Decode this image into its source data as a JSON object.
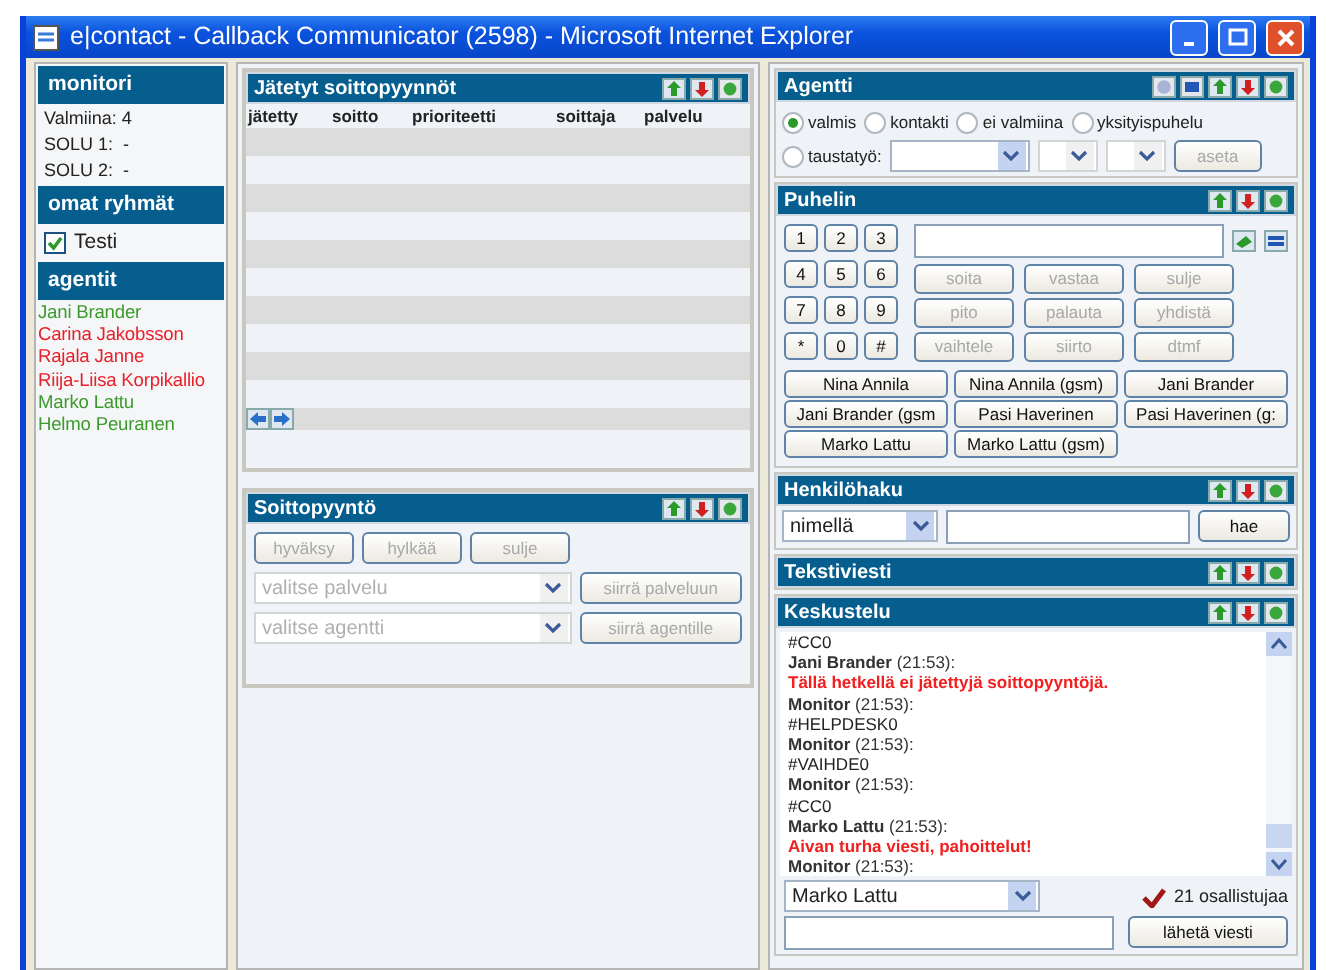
{
  "window": {
    "title": "e|contact - Callback Communicator (2598) - Microsoft Internet Explorer"
  },
  "monitor": {
    "title": "monitori",
    "lines": [
      "Valmiina: 4",
      "SOLU 1:  -",
      "SOLU 2:  -"
    ]
  },
  "groups": {
    "title": "omat ryhmät",
    "items": [
      {
        "label": "Testi",
        "checked": true
      }
    ]
  },
  "agents": {
    "title": "agentit",
    "items": [
      {
        "name": "Jani Brander",
        "color": "#3c9a2c"
      },
      {
        "name": "Carina Jakobsson",
        "color": "#e8202a"
      },
      {
        "name": "Rajala Janne",
        "color": "#e8202a"
      },
      {
        "name": "Riija-Liisa Korpikallio",
        "color": "#e8202a"
      },
      {
        "name": "Marko Lattu",
        "color": "#3c9a2c"
      },
      {
        "name": "Helmo Peuranen",
        "color": "#3c9a2c"
      }
    ]
  },
  "requests": {
    "title": "Jätetyt soittopyynnöt",
    "columns": [
      "jätetty",
      "soitto",
      "prioriteetti",
      "soittaja",
      "palvelu"
    ]
  },
  "callback": {
    "title": "Soittopyyntö",
    "buttons": [
      {
        "label": "hyväksy",
        "disabled": true
      },
      {
        "label": "hylkää",
        "disabled": true
      },
      {
        "label": "sulje",
        "disabled": true
      }
    ],
    "transfers": [
      {
        "placeholder": "valitse palvelu",
        "button": "siirrä palveluun",
        "disabled": true
      },
      {
        "placeholder": "valitse agentti",
        "button": "siirrä agentille",
        "disabled": true
      }
    ]
  },
  "agent_panel": {
    "title": "Agentti",
    "statuses": [
      {
        "label": "valmis",
        "selected": true
      },
      {
        "label": "kontakti",
        "selected": false
      },
      {
        "label": "ei valmiina",
        "selected": false
      },
      {
        "label": "yksityispuhelu",
        "selected": false
      },
      {
        "label": "taustatyö:",
        "selected": false
      }
    ],
    "work_selects": [
      {
        "disabled": false
      },
      {
        "disabled": true
      },
      {
        "disabled": true
      }
    ],
    "set_button": {
      "label": "aseta",
      "disabled": true
    }
  },
  "phone": {
    "title": "Puhelin",
    "keys": [
      "1",
      "2",
      "3",
      "4",
      "5",
      "6",
      "7",
      "8",
      "9",
      "*",
      "0",
      "#"
    ],
    "actions": [
      {
        "label": "soita",
        "disabled": true
      },
      {
        "label": "vastaa",
        "disabled": true
      },
      {
        "label": "sulje",
        "disabled": true
      },
      {
        "label": "pito",
        "disabled": true
      },
      {
        "label": "palauta",
        "disabled": true
      },
      {
        "label": "yhdistä",
        "disabled": true
      },
      {
        "label": "vaihtele",
        "disabled": true
      },
      {
        "label": "siirto",
        "disabled": true
      },
      {
        "label": "dtmf",
        "disabled": true
      }
    ],
    "contacts": [
      "Nina Annila",
      "Nina Annila (gsm)",
      "Jani Brander",
      "Jani Brander (gsm",
      "Pasi Haverinen",
      "Pasi Haverinen (g:",
      "Marko Lattu",
      "Marko Lattu (gsm)"
    ]
  },
  "search": {
    "title": "Henkilöhaku",
    "by": "nimellä",
    "button": "hae"
  },
  "sms": {
    "title": "Tekstiviesti"
  },
  "chat": {
    "title": "Keskustelu",
    "messages": [
      {
        "kind": "text",
        "text": "#CC0"
      },
      {
        "kind": "sender",
        "text": "**Jani Brander** (21:53):"
      },
      {
        "kind": "alert",
        "text": "Tällä hetkellä ei jätettyjä soittopyyntöjä."
      },
      {
        "kind": "sender",
        "text": "**Monitor** (21:53):"
      },
      {
        "kind": "text",
        "text": "#HELPDESK0"
      },
      {
        "kind": "sender",
        "text": "**Monitor** (21:53):"
      },
      {
        "kind": "text",
        "text": "#VAIHDE0"
      },
      {
        "kind": "sender",
        "text": "**Monitor** (21:53):"
      },
      {
        "kind": "text",
        "text": "#CC0"
      },
      {
        "kind": "sender",
        "text": "**Marko Lattu** (21:53):"
      },
      {
        "kind": "alert",
        "text": "Aivan turha viesti, pahoittelut!"
      },
      {
        "kind": "sender",
        "text": "**Monitor** (21:53):"
      }
    ],
    "recipient": "Marko Lattu",
    "participants": "21 osallistujaa",
    "send_button": "lähetä viesti"
  }
}
